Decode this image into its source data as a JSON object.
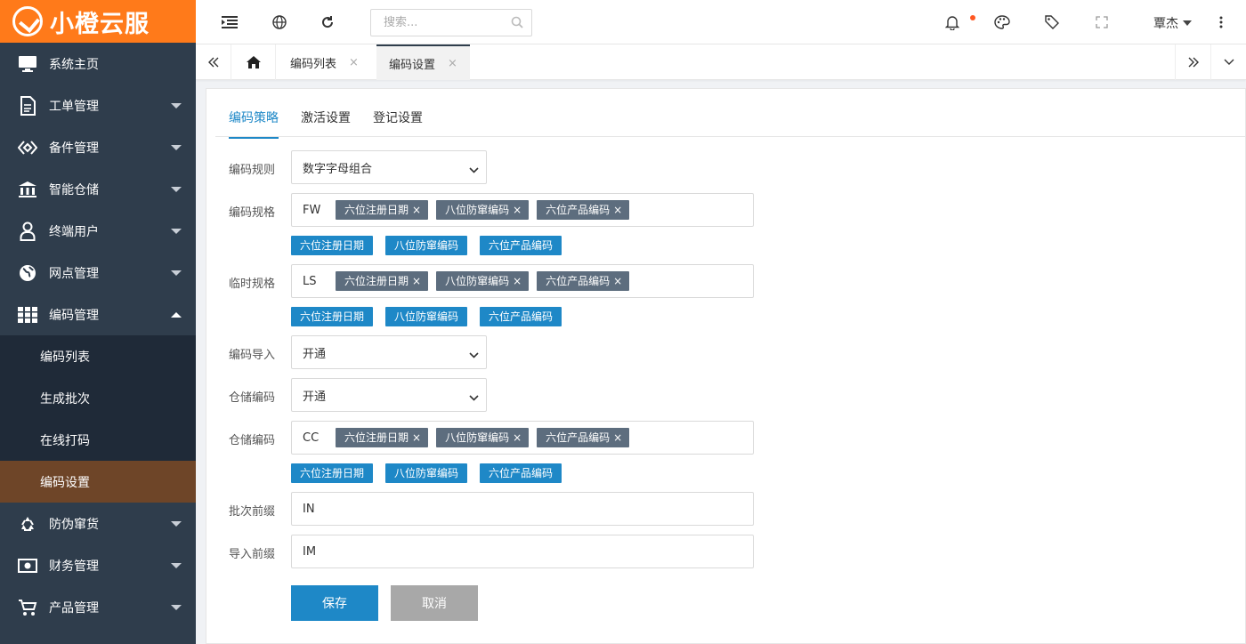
{
  "app": {
    "logo_text": "小橙云服",
    "brand_color": "#ff7a1a"
  },
  "sidebar": {
    "items": [
      {
        "label": "系统主页",
        "icon": "monitor-icon"
      },
      {
        "label": "工单管理",
        "icon": "document-icon"
      },
      {
        "label": "备件管理",
        "icon": "parts-icon"
      },
      {
        "label": "智能仓储",
        "icon": "warehouse-icon"
      },
      {
        "label": "终端用户",
        "icon": "user-icon"
      },
      {
        "label": "网点管理",
        "icon": "globe-icon"
      },
      {
        "label": "编码管理",
        "icon": "grid-icon",
        "expanded": true
      }
    ],
    "sub_items": [
      {
        "label": "编码列表"
      },
      {
        "label": "生成批次"
      },
      {
        "label": "在线打码"
      },
      {
        "label": "编码设置",
        "active": true
      }
    ],
    "items_after": [
      {
        "label": "防伪窜货",
        "icon": "recycle-icon"
      },
      {
        "label": "财务管理",
        "icon": "money-icon"
      },
      {
        "label": "产品管理",
        "icon": "cart-icon"
      }
    ]
  },
  "topbar": {
    "search_placeholder": "搜索...",
    "user_name": "覃杰"
  },
  "tabs": [
    {
      "label": "编码列表",
      "close": "×"
    },
    {
      "label": "编码设置",
      "close": "×",
      "active": true
    }
  ],
  "subtabs": [
    "编码策略",
    "激活设置",
    "登记设置"
  ],
  "form": {
    "rule": {
      "label": "编码规则",
      "value": "数字字母组合"
    },
    "spec": {
      "label": "编码规格",
      "prefix": "FW"
    },
    "temp": {
      "label": "临时规格",
      "prefix": "LS"
    },
    "import": {
      "label": "编码导入",
      "value": "开通"
    },
    "storage": {
      "label": "仓储编码",
      "value": "开通"
    },
    "storage_spec": {
      "label": "仓储编码",
      "prefix": "CC"
    },
    "batch": {
      "label": "批次前缀",
      "value": "IN"
    },
    "import_prefix": {
      "label": "导入前缀",
      "value": "IM"
    },
    "tag_labels": [
      "六位注册日期",
      "八位防窜编码",
      "六位产品编码"
    ],
    "tag_close": "×",
    "save_label": "保存",
    "cancel_label": "取消"
  }
}
